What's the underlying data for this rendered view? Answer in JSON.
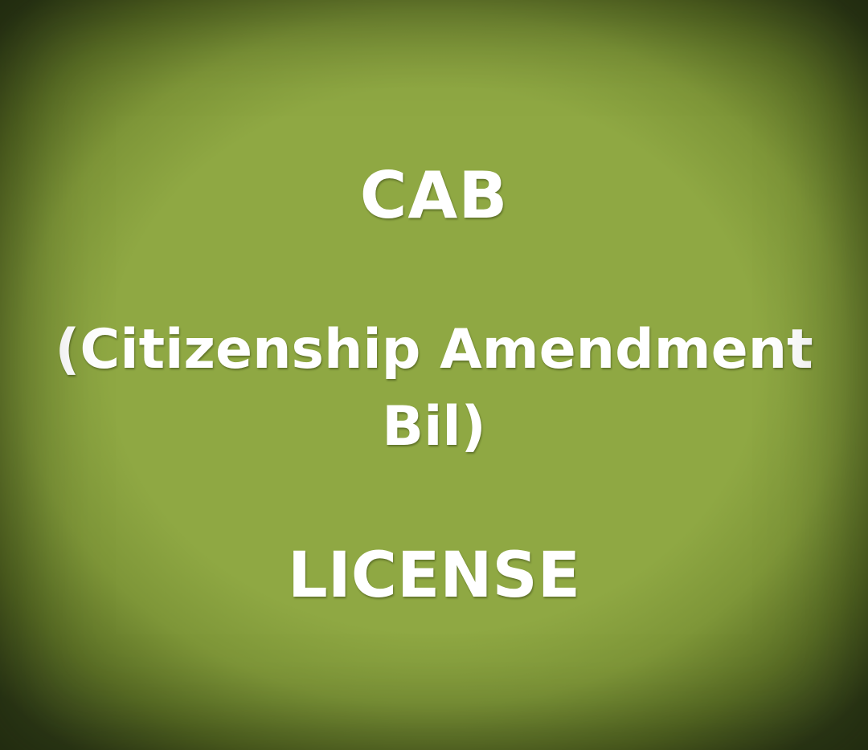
{
  "text": {
    "title": "CAB",
    "subtitle_line1": "(Citizenship Amendment",
    "subtitle_line2": "Bil)",
    "footer": "LICENSE"
  },
  "colors": {
    "background_center": "#8fa843",
    "background_edge": "#33401a",
    "text": "#ffffff"
  }
}
